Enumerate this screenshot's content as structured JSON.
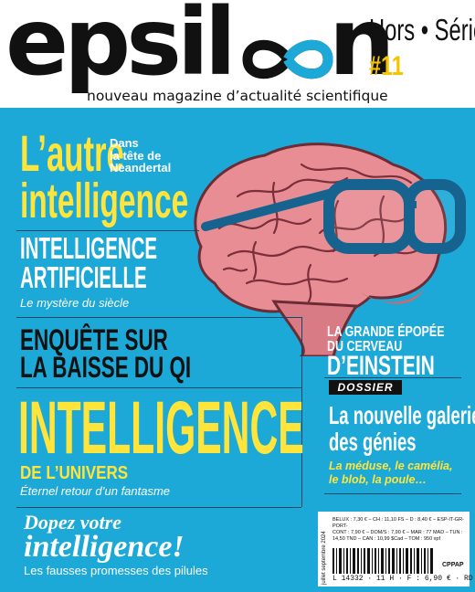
{
  "masthead": {
    "brand_part1": "epsil",
    "brand_part2": "n",
    "series_label": "Hors • Série",
    "issue": "#11",
    "tagline": "nouveau magazine d’actualité scientifique"
  },
  "colors": {
    "cover_background": "#1da9d8",
    "accent_yellow": "#ffe53b",
    "issue_yellow": "#f5c400",
    "brain_pink": "#e98d94",
    "glasses_blue": "#17638f"
  },
  "cover_stories": {
    "autre": {
      "title_line1": "L’autre",
      "title_line2": "intelligence",
      "kicker": [
        "Dans",
        "la tête de",
        "Neandertal"
      ]
    },
    "ia": {
      "line1": "INTELLIGENCE",
      "line2": "ARTIFICIELLE",
      "subtitle": "Le mystère du siècle"
    },
    "enquete": {
      "line1": "ENQUÊTE SUR",
      "line2": "LA BAISSE DU QI"
    },
    "univers": {
      "title": "INTELLIGENCE",
      "subtitle_upper": "DE L’UNIVERS",
      "subtitle": "Éternel retour d’un fantasme"
    },
    "dopez": {
      "line1": "Dopez votre",
      "line2": "intelligence!",
      "subtitle": "Les fausses promesses des pilules"
    },
    "einstein": {
      "line1": "LA GRANDE ÉPOPÉE",
      "line2": "DU CERVEAU",
      "line3": "D’EINSTEIN"
    },
    "dossier": {
      "badge": "DOSSIER",
      "title_line1": "La nouvelle galerie",
      "title_line2": "des génies",
      "subtitle_line1": "La méduse, le camélia,",
      "subtitle_line2": "le blob, la poule…"
    }
  },
  "barcode": {
    "vertical_date": "juillet septembre 2024",
    "prices_line1": "BELUX : 7,30 € – CH : 11,10 FS – D : 8,40 € – ESP-IT-GR-PORT-",
    "prices_line2": "CONT : 7,90 € – DOM/S : 7,90 € – MAR : 77 MAD – TUN :",
    "prices_line3": "14,50 TND – CAN : 10,99 $Cad – TOM : 950 xpf",
    "code": "L 14332 · 11 H · F : 6,90 € · RD",
    "cppap": "CPPAP"
  }
}
